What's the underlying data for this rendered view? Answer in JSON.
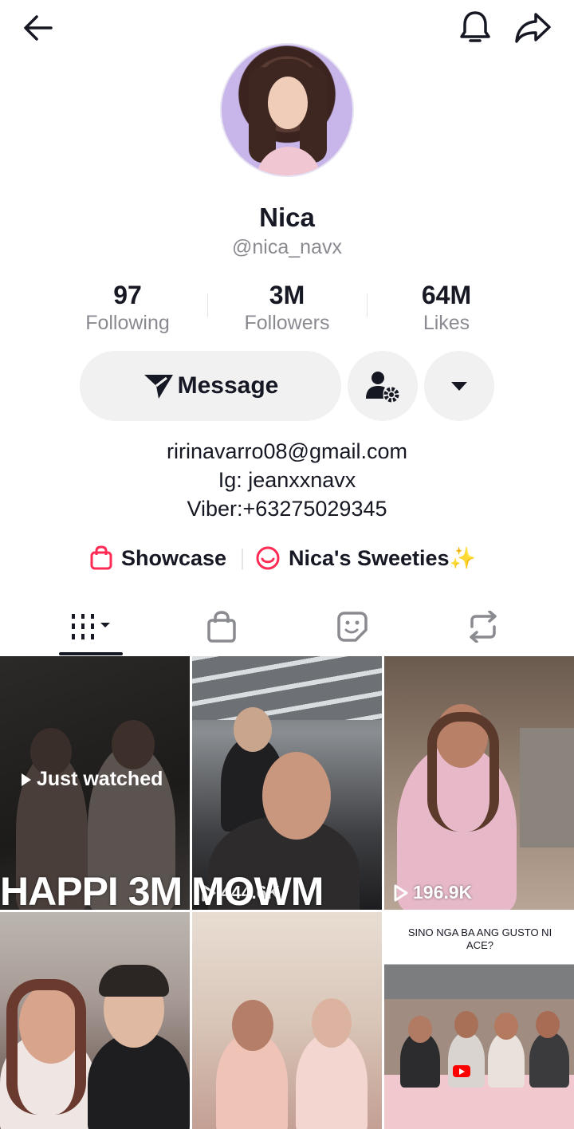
{
  "profile": {
    "display_name": "Nica",
    "username": "@nica_navx"
  },
  "stats": [
    {
      "value": "97",
      "label": "Following"
    },
    {
      "value": "3M",
      "label": "Followers"
    },
    {
      "value": "64M",
      "label": "Likes"
    }
  ],
  "actions": {
    "message_label": "Message"
  },
  "bio": {
    "line1": "ririnavarro08@gmail.com",
    "line2": "Ig: jeanxxnavx",
    "line3": "Viber:+63275029345"
  },
  "links": {
    "showcase": "Showcase",
    "sweeties": "Nica's Sweeties✨"
  },
  "videos": [
    {
      "label": "Just watched",
      "overlay": "HAPPI 3M",
      "overlay_2": "MOWM",
      "views": "444.6K"
    },
    {
      "views": ""
    },
    {
      "views": "196.9K"
    },
    {},
    {},
    {
      "caption": "SINO NGA BA ANG GUSTO NI ACE?"
    }
  ],
  "colors": {
    "accent_pink": "#fe2c55",
    "text_primary": "#161823",
    "text_secondary": "#8a8b91",
    "button_bg": "#f1f1f2"
  }
}
